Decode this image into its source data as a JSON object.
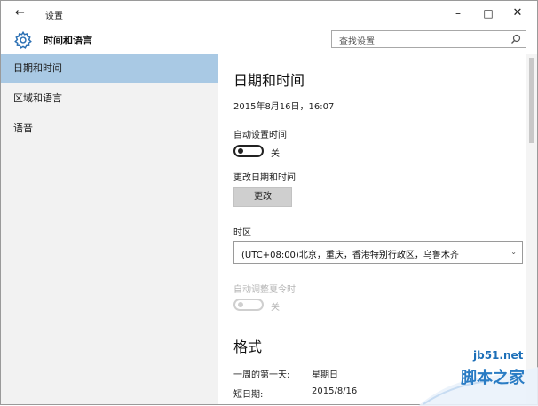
{
  "titlebar": {
    "back_icon": "back-arrow-icon",
    "title": "设置",
    "min_icon": "minimize-icon",
    "max_icon": "maximize-icon",
    "close_icon": "close-icon"
  },
  "header": {
    "icon": "gear-icon",
    "title": "时间和语言",
    "search_placeholder": "查找设置",
    "search_icon": "search-icon"
  },
  "sidebar": {
    "items": [
      {
        "label": "日期和时间",
        "active": true
      },
      {
        "label": "区域和语言",
        "active": false
      },
      {
        "label": "语音",
        "active": false
      }
    ]
  },
  "content": {
    "heading": "日期和时间",
    "current_datetime": "2015年8月16日，16:07",
    "auto_time": {
      "label": "自动设置时间",
      "state_text": "关",
      "on": false
    },
    "change_datetime": {
      "label": "更改日期和时间",
      "button_label": "更改"
    },
    "timezone": {
      "label": "时区",
      "value": "(UTC+08:00)北京，重庆，香港特别行政区，乌鲁木齐"
    },
    "dst": {
      "label": "自动调整夏令时",
      "state_text": "关",
      "on": false,
      "disabled": true
    },
    "format": {
      "heading": "格式",
      "rows": [
        {
          "key": "一周的第一天:",
          "value": "星期日"
        },
        {
          "key": "短日期:",
          "value": "2015/8/16"
        }
      ]
    }
  },
  "watermark": {
    "url": "jb51.net",
    "name": "脚本之家"
  },
  "colors": {
    "sidebar_bg": "#f2f2f2",
    "sidebar_active": "#a9c9e4",
    "button_bg": "#cfcfcf",
    "watermark": "#2a7cc4"
  }
}
